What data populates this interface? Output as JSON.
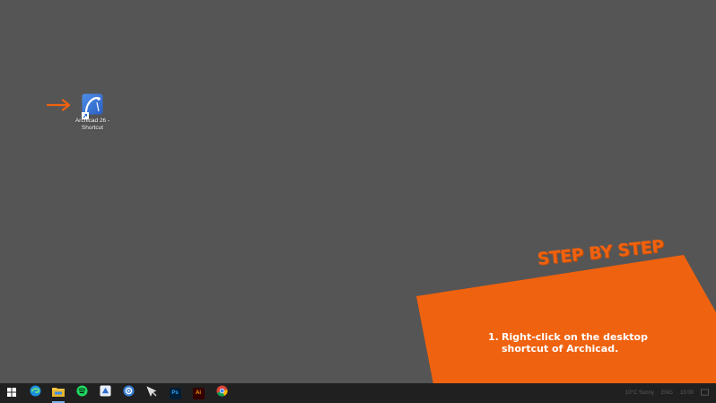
{
  "desktop": {
    "icon": {
      "label": "Archicad 26 -\nShortcut",
      "icon_name": "archicad-app-icon"
    },
    "background_color": "#555555",
    "pointer_color": "#ef620f"
  },
  "callout": {
    "title": "STEP BY STEP",
    "step_number": "1.",
    "step_text": "Right-click on the desktop shortcut of Archicad.",
    "color": "#ef620f"
  },
  "taskbar": {
    "items": [
      {
        "name": "start-menu-icon"
      },
      {
        "name": "edge-icon"
      },
      {
        "name": "file-explorer-icon"
      },
      {
        "name": "spotify-icon"
      },
      {
        "name": "app-icon-blue"
      },
      {
        "name": "settings-app-icon"
      },
      {
        "name": "cursor-tool-icon"
      },
      {
        "name": "photoshop-icon",
        "label": "Ps"
      },
      {
        "name": "illustrator-icon",
        "label": "Ai"
      },
      {
        "name": "chrome-icon"
      }
    ],
    "tray": {
      "weather": "10°C Sunny",
      "language": "ENG",
      "time": "10:00"
    }
  }
}
